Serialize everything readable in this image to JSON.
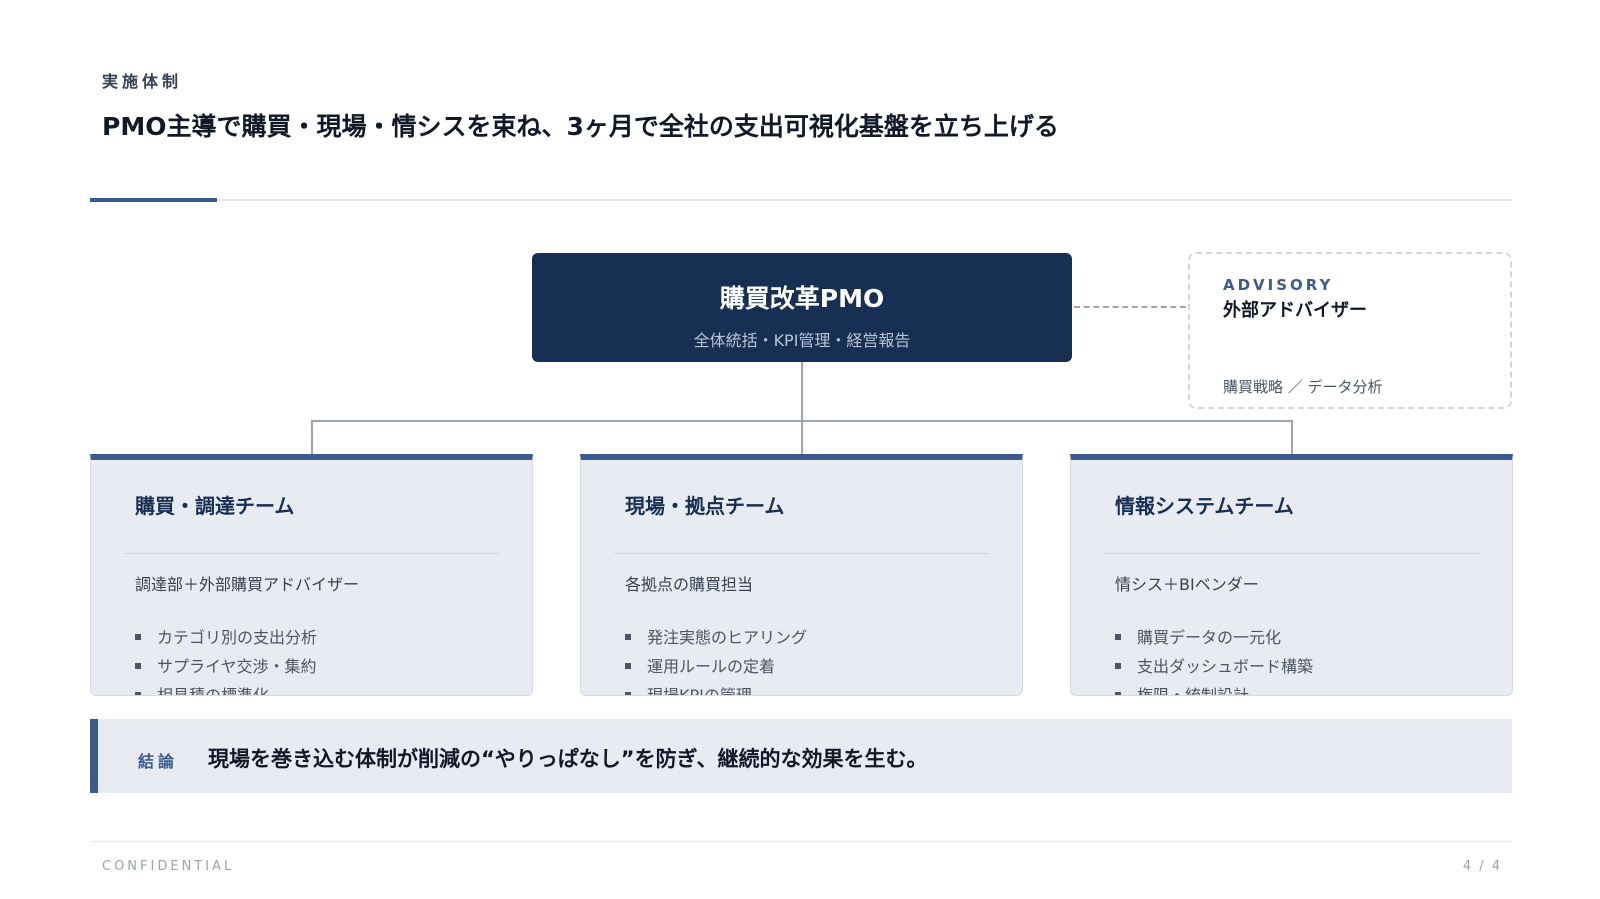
{
  "header": {
    "kicker": "実施体制",
    "title": "PMO主導で購買・現場・情シスを束ね、3ヶ月で全社の支出可視化基盤を立ち上げる"
  },
  "pmo": {
    "title": "購買改革PMO",
    "subtitle": "全体統括・KPI管理・経営報告"
  },
  "advisory": {
    "label": "ADVISORY",
    "title": "外部アドバイザー",
    "subtitle": "購買戦略 ／ データ分析"
  },
  "teams": [
    {
      "title": "購買・調達チーム",
      "members": "調達部＋外部購買アドバイザー",
      "items": [
        "カテゴリ別の支出分析",
        "サプライヤ交渉・集約",
        "相見積の標準化"
      ]
    },
    {
      "title": "現場・拠点チーム",
      "members": "各拠点の購買担当",
      "items": [
        "発注実態のヒアリング",
        "運用ルールの定着",
        "現場KPIの管理"
      ]
    },
    {
      "title": "情報システムチーム",
      "members": "情シス＋BIベンダー",
      "items": [
        "購買データの一元化",
        "支出ダッシュボード構築",
        "権限・統制設計"
      ]
    }
  ],
  "conclusion": {
    "label": "結論",
    "text": "現場を巻き込む体制が削減の“やりっぱなし”を防ぎ、継続的な効果を生む。"
  },
  "footer": {
    "confidential": "CONFIDENTIAL",
    "page": "4 / 4"
  },
  "colors": {
    "navy": "#172f52",
    "accent": "#3d5a8f",
    "card_bg": "#e8ebf2"
  }
}
